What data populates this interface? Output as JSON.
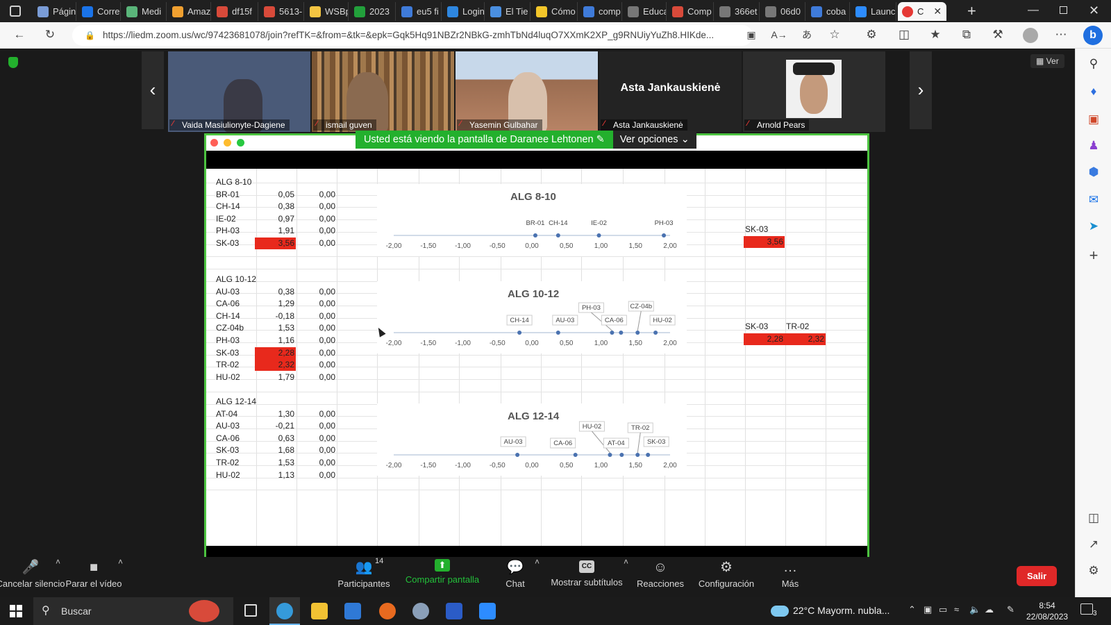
{
  "browser": {
    "tabs": [
      {
        "label": "Págin",
        "color": "#7a9cd6"
      },
      {
        "label": "Corre",
        "color": "#1a73e8"
      },
      {
        "label": "Medi",
        "color": "#5ab57a"
      },
      {
        "label": "Amaz",
        "color": "#f0a030"
      },
      {
        "label": "df15f",
        "color": "#d84a3a"
      },
      {
        "label": "5613-",
        "color": "#d84a3a"
      },
      {
        "label": "WSBp",
        "color": "#f4c542"
      },
      {
        "label": "2023",
        "color": "#22a03b"
      },
      {
        "label": "eu5 fi",
        "color": "#3f7bd9"
      },
      {
        "label": "Login",
        "color": "#2e87e0"
      },
      {
        "label": "El Tie",
        "color": "#4a8fe0"
      },
      {
        "label": "Cómo",
        "color": "#f3c62a"
      },
      {
        "label": "comp",
        "color": "#3f7bd9"
      },
      {
        "label": "Educa",
        "color": "#777777"
      },
      {
        "label": "Comp",
        "color": "#d84a3a"
      },
      {
        "label": "366et",
        "color": "#777777"
      },
      {
        "label": "06d0",
        "color": "#777777"
      },
      {
        "label": "coba",
        "color": "#3f7bd9"
      },
      {
        "label": "Launc",
        "color": "#2d8cff"
      },
      {
        "label": "C",
        "color": "#e53935"
      }
    ],
    "url": "https://liedm.zoom.us/wc/97423681078/join?refTK=&from=&tk=&epk=Gqk5Hq91NBZr2NBkG-zmhTbNd4luqO7XXmK2XP_g9RNUiyYuZh8.HIKde..."
  },
  "zoom": {
    "view_label": "Ver",
    "participants_strip": [
      {
        "name": "Vaida Masiulionyte-Dagiene",
        "bg": "#4a5a78",
        "fg": "#9bb0cf"
      },
      {
        "name": "ismail guven",
        "bg": "#6b5238",
        "fg": "#a58963"
      },
      {
        "name": "Yasemin Gulbahar",
        "bg": "#8a6c56",
        "fg": "#c7a88a"
      },
      {
        "name": "Asta Jankauskienė",
        "big_name": "Asta Jankauskienė",
        "bg": "#232323",
        "fg": "#232323"
      },
      {
        "name": "Arnold Pears",
        "bg": "#2c2c2c",
        "fg": "#555555"
      }
    ],
    "banner": {
      "text": "Usted está viendo la pantalla de Daranee Lehtonen",
      "options": "Ver opciones"
    },
    "controls": [
      {
        "label": "Cancelar silencio",
        "icon": "mic-off-icon"
      },
      {
        "label": "Parar el vídeo",
        "icon": "video-icon"
      },
      {
        "label": "Participantes",
        "icon": "participants-icon",
        "count": "14"
      },
      {
        "label": "Compartir pantalla",
        "icon": "share-screen-icon"
      },
      {
        "label": "Chat",
        "icon": "chat-icon"
      },
      {
        "label": "Mostrar subtítulos",
        "icon": "cc-icon"
      },
      {
        "label": "Reacciones",
        "icon": "smile-icon"
      },
      {
        "label": "Configuración",
        "icon": "gear-icon"
      },
      {
        "label": "Más",
        "icon": "more-icon"
      }
    ],
    "leave_label": "Salir"
  },
  "sheet": {
    "groups": [
      {
        "title": "ALG 8-10",
        "rows": [
          {
            "code": "BR-01",
            "v1": "0,05",
            "v2": "0,00",
            "hl": false
          },
          {
            "code": "CH-14",
            "v1": "0,38",
            "v2": "0,00",
            "hl": false
          },
          {
            "code": "IE-02",
            "v1": "0,97",
            "v2": "0,00",
            "hl": false
          },
          {
            "code": "PH-03",
            "v1": "1,91",
            "v2": "0,00",
            "hl": false
          },
          {
            "code": "SK-03",
            "v1": "3,56",
            "v2": "0,00",
            "hl": true
          }
        ]
      },
      {
        "title": "ALG 10-12",
        "rows": [
          {
            "code": "AU-03",
            "v1": "0,38",
            "v2": "0,00",
            "hl": false
          },
          {
            "code": "CA-06",
            "v1": "1,29",
            "v2": "0,00",
            "hl": false
          },
          {
            "code": "CH-14",
            "v1": "-0,18",
            "v2": "0,00",
            "hl": false
          },
          {
            "code": "CZ-04b",
            "v1": "1,53",
            "v2": "0,00",
            "hl": false
          },
          {
            "code": "PH-03",
            "v1": "1,16",
            "v2": "0,00",
            "hl": false
          },
          {
            "code": "SK-03",
            "v1": "2,28",
            "v2": "0,00",
            "hl": true
          },
          {
            "code": "TR-02",
            "v1": "2,32",
            "v2": "0,00",
            "hl": true
          },
          {
            "code": "HU-02",
            "v1": "1,79",
            "v2": "0,00",
            "hl": false
          }
        ]
      },
      {
        "title": "ALG 12-14",
        "rows": [
          {
            "code": "AT-04",
            "v1": "1,30",
            "v2": "0,00",
            "hl": false
          },
          {
            "code": "AU-03",
            "v1": "-0,21",
            "v2": "0,00",
            "hl": false
          },
          {
            "code": "CA-06",
            "v1": "0,63",
            "v2": "0,00",
            "hl": false
          },
          {
            "code": "SK-03",
            "v1": "1,68",
            "v2": "0,00",
            "hl": false
          },
          {
            "code": "TR-02",
            "v1": "1,53",
            "v2": "0,00",
            "hl": false
          },
          {
            "code": "HU-02",
            "v1": "1,13",
            "v2": "0,00",
            "hl": false
          }
        ]
      }
    ],
    "outliers": [
      {
        "cells": [
          {
            "code": "SK-03",
            "value": "3,56"
          }
        ]
      },
      {
        "cells": [
          {
            "code": "SK-03",
            "value": "2,28"
          },
          {
            "code": "TR-02",
            "value": "2,32"
          }
        ]
      }
    ],
    "highlight_color": "#e8291c"
  },
  "chart_data": [
    {
      "type": "scatter",
      "title": "ALG 8-10",
      "xlim": [
        -2.0,
        2.0
      ],
      "x_ticks": [
        "-2,00",
        "-1,50",
        "-1,00",
        "-0,50",
        "0,00",
        "0,50",
        "1,00",
        "1,50",
        "2,00"
      ],
      "points": [
        {
          "label": "BR-01",
          "x": 0.05,
          "y": 0
        },
        {
          "label": "CH-14",
          "x": 0.38,
          "y": 0
        },
        {
          "label": "IE-02",
          "x": 0.97,
          "y": 0
        },
        {
          "label": "PH-03",
          "x": 1.91,
          "y": 0
        }
      ]
    },
    {
      "type": "scatter",
      "title": "ALG 10-12",
      "xlim": [
        -2.0,
        2.0
      ],
      "x_ticks": [
        "-2,00",
        "-1,50",
        "-1,00",
        "-0,50",
        "0,00",
        "0,50",
        "1,00",
        "1,50",
        "2,00"
      ],
      "points": [
        {
          "label": "CH-14",
          "x": -0.18,
          "y": 0
        },
        {
          "label": "AU-03",
          "x": 0.38,
          "y": 0
        },
        {
          "label": "PH-03",
          "x": 1.16,
          "y": 0
        },
        {
          "label": "CA-06",
          "x": 1.29,
          "y": 0
        },
        {
          "label": "CZ-04b",
          "x": 1.53,
          "y": 0
        },
        {
          "label": "HU-02",
          "x": 1.79,
          "y": 0
        }
      ]
    },
    {
      "type": "scatter",
      "title": "ALG 12-14",
      "xlim": [
        -2.0,
        2.0
      ],
      "x_ticks": [
        "-2,00",
        "-1,50",
        "-1,00",
        "-0,50",
        "0,00",
        "0,50",
        "1,00",
        "1,50",
        "2,00"
      ],
      "points": [
        {
          "label": "AU-03",
          "x": -0.21,
          "y": 0
        },
        {
          "label": "CA-06",
          "x": 0.63,
          "y": 0
        },
        {
          "label": "HU-02",
          "x": 1.13,
          "y": 0
        },
        {
          "label": "AT-04",
          "x": 1.3,
          "y": 0
        },
        {
          "label": "TR-02",
          "x": 1.53,
          "y": 0
        },
        {
          "label": "SK-03",
          "x": 1.68,
          "y": 0
        }
      ]
    }
  ],
  "taskbar": {
    "search_placeholder": "Buscar",
    "weather": "22°C  Mayorm. nubla...",
    "time": "8:54",
    "date": "22/08/2023",
    "notif_count": "3"
  }
}
